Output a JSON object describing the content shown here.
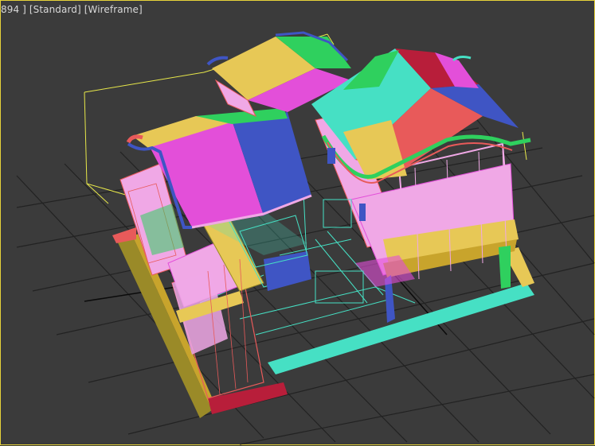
{
  "viewport": {
    "label_parts": [
      "894 ]",
      "[Standard]",
      "[Wireframe]"
    ],
    "colors": {
      "background": "#3b3b3b",
      "grid": "#222222",
      "axis": "#0a0a0a",
      "selection_box": "#e8e84a",
      "border": "#e6d23a"
    }
  },
  "scene": {
    "object_colors": [
      "#e34fd9",
      "#3f55c4",
      "#2fd05e",
      "#e7c856",
      "#e85a5a",
      "#46e0c4",
      "#b81e3a",
      "#f0a8e6",
      "#c8a42c",
      "#9a8a28"
    ]
  }
}
